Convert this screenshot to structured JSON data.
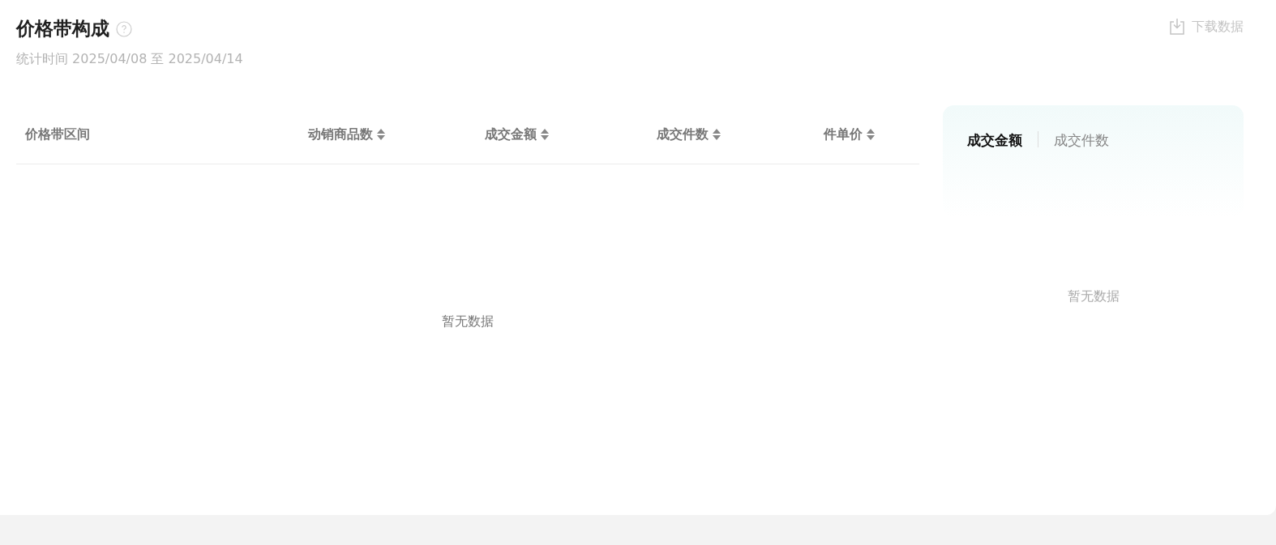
{
  "header": {
    "title": "价格带构成",
    "subtitle": "统计时间 2025/04/08 至 2025/04/14",
    "download": "下载数据"
  },
  "table": {
    "columns": [
      {
        "label": "价格带区间",
        "sortable": false
      },
      {
        "label": "动销商品数",
        "sortable": true
      },
      {
        "label": "成交金额",
        "sortable": true
      },
      {
        "label": "成交件数",
        "sortable": true
      },
      {
        "label": "件单价",
        "sortable": true
      }
    ],
    "empty": "暂无数据"
  },
  "side_panel": {
    "tabs": [
      {
        "label": "成交金额",
        "selected": true
      },
      {
        "label": "成交件数",
        "selected": false
      }
    ],
    "empty": "暂无数据"
  }
}
